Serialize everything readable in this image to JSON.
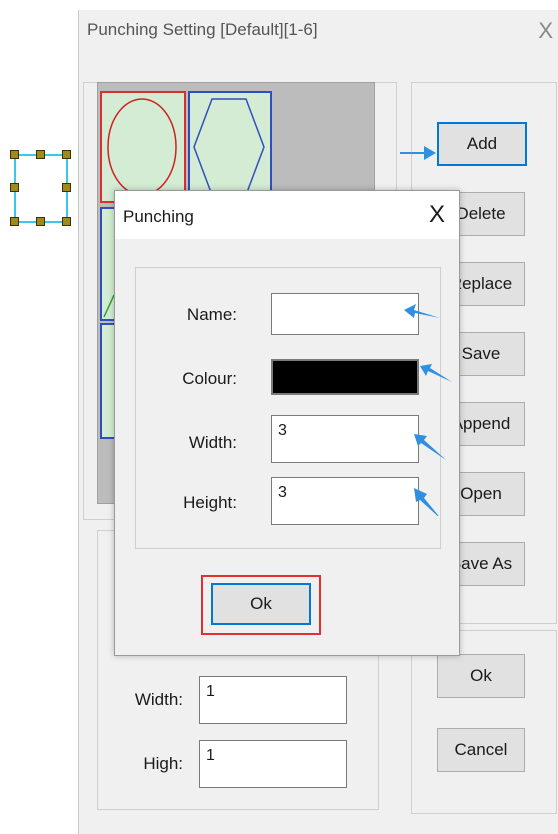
{
  "main_window": {
    "title": "Punching Setting [Default][1-6]",
    "close_glyph": "X",
    "buttons": [
      "Add",
      "Delete",
      "Replace",
      "Save",
      "Append",
      "Open",
      "Save As"
    ],
    "ok_label": "Ok",
    "cancel_label": "Cancel",
    "width_label": "Width:",
    "width_value": "1",
    "high_label": "High:",
    "high_value": "1"
  },
  "dialog": {
    "title": "Punching",
    "close_glyph": "X",
    "name_label": "Name:",
    "name_value": "",
    "colour_label": "Colour:",
    "colour_value": "#000000",
    "width_label": "Width:",
    "width_value": "3",
    "height_label": "Height:",
    "height_value": "3",
    "ok_label": "Ok"
  },
  "icons": {
    "selection_handles": "resize-handles-icon",
    "annotation_arrow": "blue-arrow-icon"
  },
  "colors": {
    "accent": "#0078d7",
    "highlight": "#e03030",
    "arrow": "#2f8fe0"
  }
}
